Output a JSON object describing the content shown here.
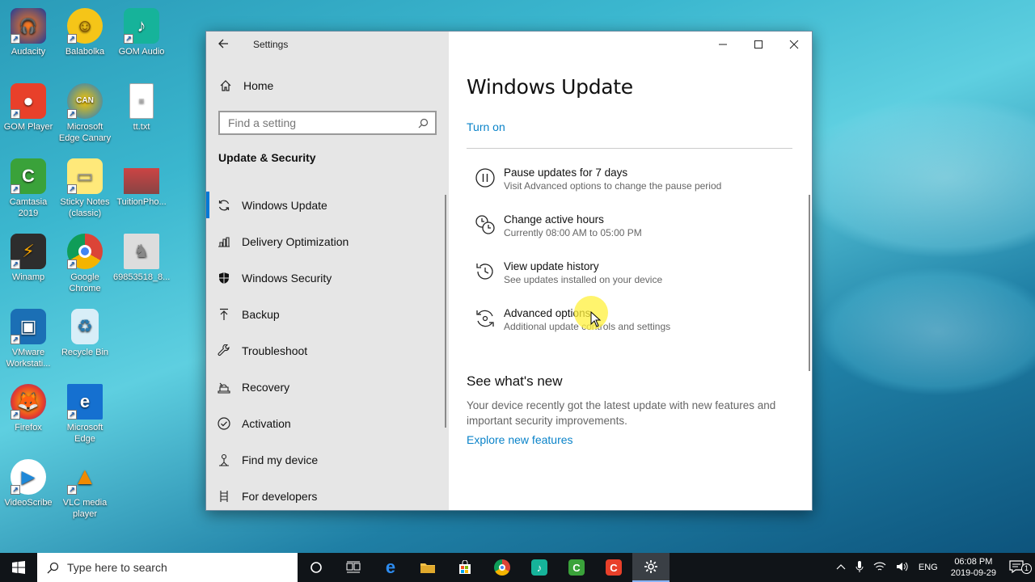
{
  "desktop": {
    "icons": [
      {
        "label": "Audacity"
      },
      {
        "label": "Balabolka"
      },
      {
        "label": "GOM Audio"
      },
      {
        "label": "GOM Player"
      },
      {
        "label": "Microsoft Edge Canary"
      },
      {
        "label": "tt.txt"
      },
      {
        "label": "Camtasia 2019"
      },
      {
        "label": "Sticky Notes (classic)"
      },
      {
        "label": "TuitionPho..."
      },
      {
        "label": "Winamp"
      },
      {
        "label": "Google Chrome"
      },
      {
        "label": "69853518_8..."
      },
      {
        "label": "VMware Workstati..."
      },
      {
        "label": "Recycle Bin"
      },
      {
        "label": "Firefox"
      },
      {
        "label": "Microsoft Edge"
      },
      {
        "label": "VideoScribe"
      },
      {
        "label": "VLC media player"
      }
    ]
  },
  "window": {
    "title": "Settings",
    "nav": {
      "home_label": "Home",
      "search_placeholder": "Find a setting",
      "section_heading": "Update & Security",
      "items": [
        {
          "label": "Windows Update",
          "icon": "sync-icon",
          "active": true
        },
        {
          "label": "Delivery Optimization",
          "icon": "delivery-icon"
        },
        {
          "label": "Windows Security",
          "icon": "shield-icon"
        },
        {
          "label": "Backup",
          "icon": "upload-arrow-icon"
        },
        {
          "label": "Troubleshoot",
          "icon": "wrench-icon"
        },
        {
          "label": "Recovery",
          "icon": "recovery-icon"
        },
        {
          "label": "Activation",
          "icon": "check-circle-icon"
        },
        {
          "label": "Find my device",
          "icon": "person-location-icon"
        },
        {
          "label": "For developers",
          "icon": "developer-icon"
        }
      ]
    },
    "main": {
      "title": "Windows Update",
      "turn_on_label": "Turn on",
      "options": [
        {
          "title": "Pause updates for 7 days",
          "subtitle": "Visit Advanced options to change the pause period",
          "icon": "pause-icon"
        },
        {
          "title": "Change active hours",
          "subtitle": "Currently 08:00 AM to 05:00 PM",
          "icon": "clock-icon"
        },
        {
          "title": "View update history",
          "subtitle": "See updates installed on your device",
          "icon": "history-icon"
        },
        {
          "title": "Advanced options",
          "subtitle": "Additional update controls and settings",
          "icon": "advanced-sync-icon"
        }
      ],
      "whats_new_heading": "See what's new",
      "whats_new_desc": "Your device recently got the latest update with new features and important security improvements.",
      "explore_label": "Explore new features"
    }
  },
  "taskbar": {
    "search_placeholder": "Type here to search",
    "language": "ENG",
    "time": "06:08 PM",
    "date": "2019-09-29",
    "notification_count": "1"
  },
  "colors": {
    "accent": "#0078d7",
    "link": "#0a83c9",
    "nav_bg": "#e6e6e6",
    "taskbar_bg": "#101418"
  }
}
